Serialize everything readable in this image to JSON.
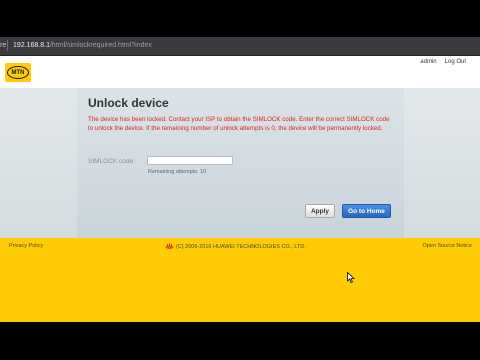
{
  "browser": {
    "security_label": "re",
    "url_host": "192.168.8.1",
    "url_path": "/html/simlockrequired.html?index"
  },
  "header": {
    "logo_text": "MTN",
    "user_label": "admin",
    "logout_label": "Log Out"
  },
  "main": {
    "title": "Unlock device",
    "warning": "The device has been locked. Contact your ISP to obtain the SIMLOCK code. Enter the correct SIMLOCK code to unlock the device. If the remaining number of unlock attempts is 0, the device will be permanently locked.",
    "code_label": "SIMLOCK code:",
    "code_value": "",
    "remaining_label": "Remaining attempts:",
    "remaining_value": "10",
    "apply_label": "Apply",
    "home_label": "Go to Home"
  },
  "footer": {
    "privacy_label": "Privacy Policy",
    "copyright": "(C) 2006-2016 HUAWEI TECHNOLOGIES CO., LTD.",
    "open_source_label": "Open Source Notice"
  },
  "colors": {
    "brand_yellow": "#ffcb05",
    "warning_red": "#e0201b",
    "primary_button": "#2468c2"
  }
}
